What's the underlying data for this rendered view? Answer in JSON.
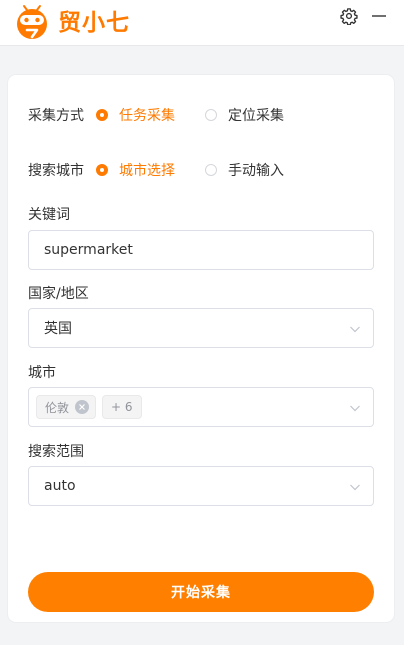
{
  "app": {
    "title": "贸小七",
    "accent": "#ff7a00",
    "settings_icon": "gear-icon",
    "minimize_icon": "minimize-icon"
  },
  "collect_method": {
    "label": "采集方式",
    "options": [
      {
        "label": "任务采集",
        "checked": true
      },
      {
        "label": "定位采集",
        "checked": false
      }
    ]
  },
  "search_city": {
    "label": "搜索城市",
    "options": [
      {
        "label": "城市选择",
        "checked": true
      },
      {
        "label": "手动输入",
        "checked": false
      }
    ]
  },
  "keyword": {
    "label": "关键词",
    "value": "supermarket"
  },
  "country": {
    "label": "国家/地区",
    "value": "英国"
  },
  "city": {
    "label": "城市",
    "tags": [
      "伦敦"
    ],
    "more": "+ 6"
  },
  "range": {
    "label": "搜索范围",
    "value": "auto"
  },
  "actions": {
    "start_label": "开始采集"
  }
}
